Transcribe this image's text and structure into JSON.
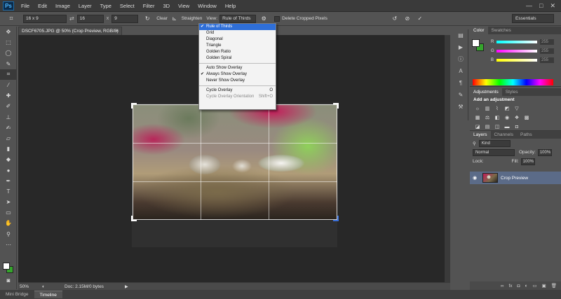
{
  "app": {
    "logo": "Ps"
  },
  "menu": [
    "File",
    "Edit",
    "Image",
    "Layer",
    "Type",
    "Select",
    "Filter",
    "3D",
    "View",
    "Window",
    "Help"
  ],
  "window_controls": [
    "—",
    "□",
    "✕"
  ],
  "options_bar": {
    "ratio": "16 x 9",
    "width": "16",
    "x_sep": "x",
    "height": "9",
    "clear_label": "Clear",
    "straighten_label": "Straighten",
    "view_label": "View:",
    "view_value": "Rule of Thirds",
    "delete_cropped_label": "Delete Cropped Pixels",
    "workspace": "Essentials"
  },
  "overlay_menu": {
    "overlays": [
      "Rule of Thirds",
      "Grid",
      "Diagonal",
      "Triangle",
      "Golden Ratio",
      "Golden Spiral"
    ],
    "selected_overlay": "Rule of Thirds",
    "show_modes": [
      "Auto Show Overlay",
      "Always Show Overlay",
      "Never Show Overlay"
    ],
    "checked_show_mode": "Always Show Overlay",
    "cycle_overlay": "Cycle Overlay",
    "cycle_overlay_shortcut": "O",
    "cycle_orientation": "Cycle Overlay Orientation",
    "cycle_orientation_shortcut": "Shift+O"
  },
  "document": {
    "tab_title": "DSCF6705.JPG @ 50% (Crop Preview, RGB/8) *",
    "tab_close": "×",
    "zoom": "50%",
    "doc_info": "Doc: 2.15M/0 bytes"
  },
  "bottom_tabs": [
    "Mini Bridge",
    "Timeline"
  ],
  "color_panel": {
    "tabs": [
      "Color",
      "Swatches"
    ],
    "channels": [
      {
        "label": "R",
        "value": "255",
        "gradient": "linear-gradient(90deg, #00ffff, #ffffff)"
      },
      {
        "label": "G",
        "value": "255",
        "gradient": "linear-gradient(90deg, #ff00ff, #ffffff)"
      },
      {
        "label": "B",
        "value": "255",
        "gradient": "linear-gradient(90deg, #ffff00, #ffffff)"
      }
    ],
    "foreground": "#ffffff",
    "background": "#35a42c"
  },
  "adjustments_panel": {
    "tabs": [
      "Adjustments",
      "Styles"
    ],
    "title": "Add an adjustment"
  },
  "layers_panel": {
    "tabs": [
      "Layers",
      "Channels",
      "Paths"
    ],
    "kind": "Kind",
    "blend_mode": "Normal",
    "opacity_label": "Opacity:",
    "opacity_value": "100%",
    "lock_label": "Lock:",
    "fill_label": "Fill:",
    "fill_value": "100%",
    "layer_name": "Crop Preview"
  }
}
